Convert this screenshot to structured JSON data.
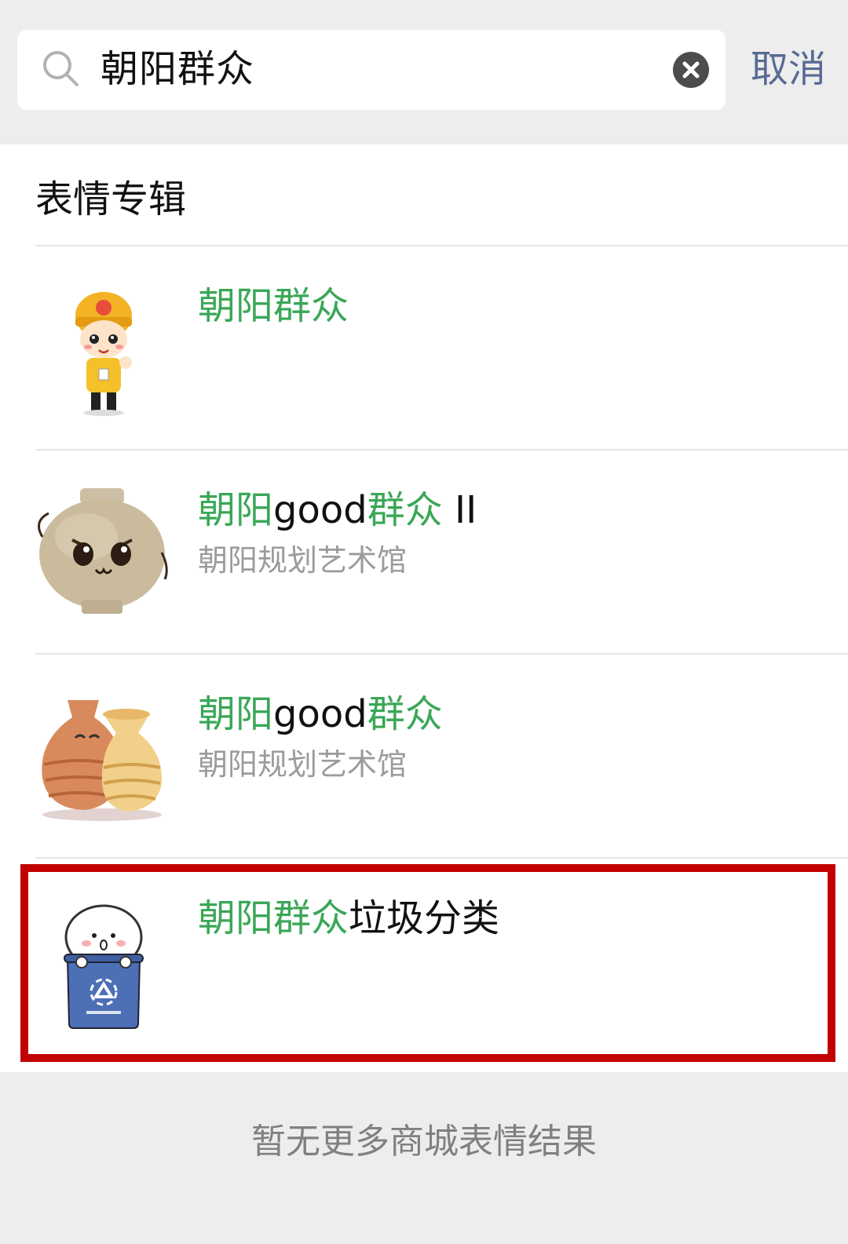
{
  "search": {
    "query": "朝阳群众",
    "cancel_label": "取消"
  },
  "section": {
    "title": "表情专辑"
  },
  "results": [
    {
      "title_highlight_1": "朝阳群众",
      "title_plain": "",
      "title_highlight_2": "",
      "title_suffix": "",
      "author": "",
      "thumbnail": "cartoon-boy-yellow-cap"
    },
    {
      "title_highlight_1": "朝阳",
      "title_plain": "good",
      "title_highlight_2": "群众",
      "title_suffix": " II",
      "author": "朝阳规划艺术馆",
      "thumbnail": "clay-pot-face"
    },
    {
      "title_highlight_1": "朝阳",
      "title_plain": "good",
      "title_highlight_2": "群众",
      "title_suffix": "",
      "author": "朝阳规划艺术馆",
      "thumbnail": "two-vases"
    },
    {
      "title_highlight_1": "朝阳群众",
      "title_plain": "垃圾分类",
      "title_highlight_2": "",
      "title_suffix": "",
      "author": "",
      "thumbnail": "recycle-bin-mascot"
    }
  ],
  "footer": {
    "note": "暂无更多商城表情结果"
  },
  "colors": {
    "highlight": "#3aa757",
    "link": "#576b95",
    "frame": "#c20000"
  }
}
